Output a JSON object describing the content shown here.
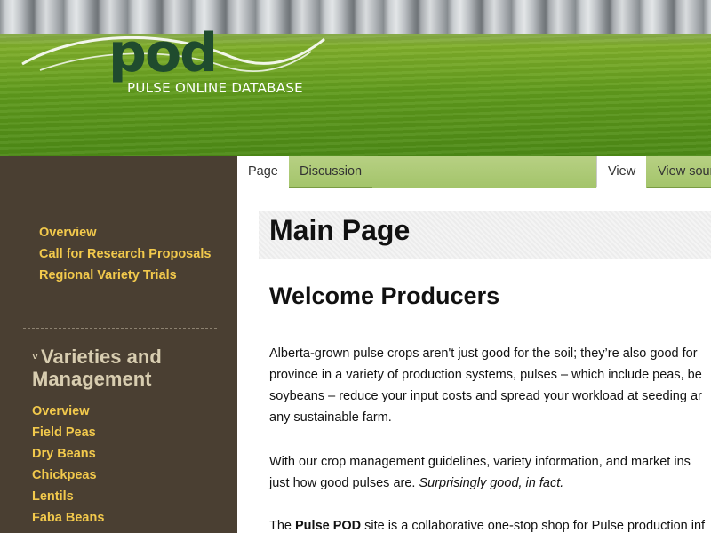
{
  "header": {
    "logo_word": "pod",
    "logo_tagline": "PULSE ONLINE DATABASE"
  },
  "sidebar": {
    "top_links": [
      "Overview",
      "Call for Research Proposals",
      "Regional Variety Trials"
    ],
    "section_heading_line1": "Varieties and",
    "section_heading_line2": "Management",
    "section_bullet": "˅",
    "sub_links": [
      "Overview",
      "Field Peas",
      "Dry Beans",
      "Chickpeas",
      "Lentils",
      "Faba Beans"
    ]
  },
  "tabs": {
    "page": "Page",
    "discussion": "Discussion",
    "view": "View",
    "view_source": "View source"
  },
  "main": {
    "title": "Main Page",
    "welcome_heading": "Welcome Producers",
    "para1": [
      "Alberta-grown pulse crops aren't just good for the soil; they’re also good for",
      "province in a variety of production systems, pulses – which include peas, be",
      "soybeans – reduce your input costs and spread your workload at seeding ar",
      "any sustainable farm."
    ],
    "para2_line1": "With our crop management guidelines, variety information, and market ins",
    "para2_line2_plain": "just how good pulses are. ",
    "para2_line2_em": "Surprisingly good, in fact.",
    "para3_pre": "The ",
    "para3_bold": "Pulse POD",
    "para3_post": " site is a collaborative one-stop shop for Pulse production inf"
  },
  "colors": {
    "sidebar_bg": "#4a3f32",
    "sidebar_link": "#f2c94c",
    "sidebar_heading": "#d8cdb0",
    "tabbar_bg": "#a3c46a",
    "logo_green": "#1f4b2e"
  }
}
